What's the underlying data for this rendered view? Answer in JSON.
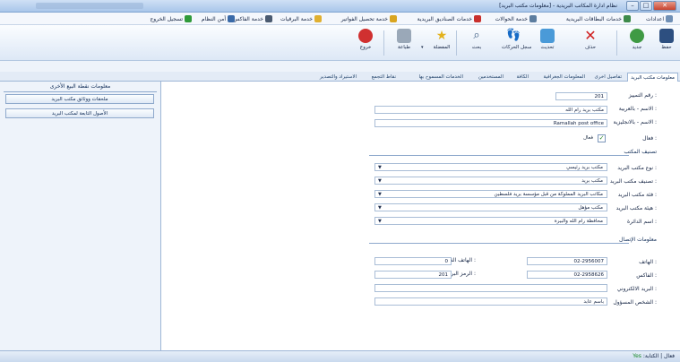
{
  "window": {
    "title": "نظام ادارة المكاتب البريدية - [معلومات مكتب البريد]"
  },
  "menu": [
    {
      "label": "اعدادات",
      "icon": "settings-icon"
    },
    {
      "label": "خدمات البطاقات البريدية",
      "icon": "postcard-icon"
    },
    {
      "label": "خدمة الحوالات",
      "icon": "money-order-icon"
    },
    {
      "label": "خدمات الصناديق البريدية",
      "icon": "mailbox-icon"
    },
    {
      "label": "خدمة تحصيل الفواتير",
      "icon": "bill-icon"
    },
    {
      "label": "خدمة البرقيات",
      "icon": "telegram-icon"
    },
    {
      "label": "خدمة الفاكس",
      "icon": "fax-icon"
    },
    {
      "label": "أمن النظام",
      "icon": "lock-icon"
    },
    {
      "label": "تسجيل الخروج",
      "icon": "logout-icon"
    }
  ],
  "toolbar": {
    "save": "حفظ",
    "new": "جديد",
    "delete": "حذف",
    "refresh": "تحديث",
    "log": "سجل الحركات",
    "search": "بحث",
    "favorite": "المفضلة",
    "print": "طباعة",
    "exit": "خروج"
  },
  "tabs": [
    "معلومات مكتب البريد",
    "تفاصيل اخرى",
    "المعلومات الجغرافية",
    "الكافة",
    "المستخدمين",
    "الخدمات المسموح بها",
    "نقاط التجمع",
    "الاستيراد والتصدير"
  ],
  "form": {
    "id_label": "رقم التمييز :",
    "id_value": "201",
    "name_ar_label": "الاسم - بالعربية :",
    "name_ar_value": "مكتب بريد رام الله",
    "name_en_label": "الاسم - بالانجليزية :",
    "name_en_value": "Ramallah post office",
    "active_label": "فعال :",
    "active_text": "فعال",
    "active_checked": true,
    "classification_section": "تصنيف المكتب",
    "type_label": "نوع مكتب البريد :",
    "type_value": "مكتب بريد رئيسي",
    "class_label": "تصنيف مكتب البريد :",
    "class_value": "مكتب بريد",
    "category_label": "فئة مكتب البريد :",
    "category_value": "مكاتب البريد المملوكة من قبل مؤسسة بريد فلسطين",
    "form_label": "هيئة مكتب البريد :",
    "form_value": "مكتب مؤهل",
    "district_label": "اسم الدائرة :",
    "district_value": "محافظة رام الله والبيرة",
    "contact_section": "معلومات الإتصال",
    "phone_label": "الهاتف :",
    "phone_value": "02-2956007",
    "ext_label": "الهاتف الفرعي :",
    "ext_value": "0",
    "fax_label": "الفاكس :",
    "fax_value": "02-2958626",
    "postal_label": "الرمز البريدي :",
    "postal_value": "201",
    "email_label": "البريد الالكتروني :",
    "email_value": "",
    "contact_label": "الشخص المسؤول :",
    "contact_value": "باسم عابد"
  },
  "side": {
    "header": "معلومات نقطة البيع الأخرى",
    "buttons": [
      "ملحقات ووثائق مكتب البريد",
      "الأصول التابعة لمكتب البريد"
    ]
  },
  "status": {
    "text": "فعال | الكتابة:",
    "yes": "Yes"
  }
}
